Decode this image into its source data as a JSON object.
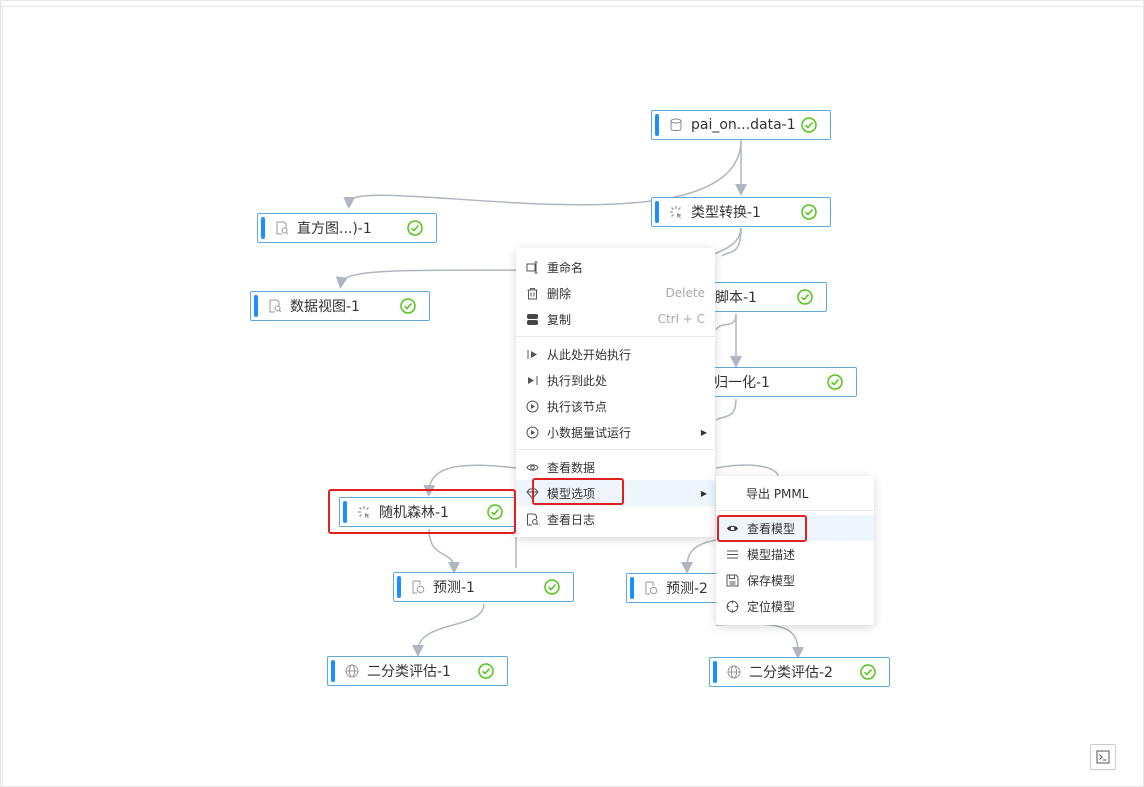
{
  "nodes": {
    "pai_data": "pai_on...data-1",
    "type_convert": "类型转换-1",
    "histogram": "直方图...)-1",
    "data_view": "数据视图-1",
    "sql_script": "脚本-1",
    "normalize": "归一化-1",
    "random_forest": "随机森林-1",
    "predict1": "预测-1",
    "predict2": "预测-2",
    "eval1": "二分类评估-1",
    "eval2": "二分类评估-2"
  },
  "context_menu": {
    "rename": "重命名",
    "delete": "删除",
    "delete_shortcut": "Delete",
    "copy": "复制",
    "copy_shortcut": "Ctrl + C",
    "run_from_here": "从此处开始执行",
    "run_to_here": "执行到此处",
    "run_node": "执行该节点",
    "small_data_run": "小数据量试运行",
    "view_data": "查看数据",
    "model_options": "模型选项",
    "view_log": "查看日志"
  },
  "submenu": {
    "export_pmml": "导出 PMML",
    "view_model": "查看模型",
    "model_description": "模型描述",
    "save_model": "保存模型",
    "locate_model": "定位模型"
  },
  "colors": {
    "node_border": "#5fa8e0",
    "node_bar": "#1890ff",
    "success": "#52c41a",
    "highlight": "#e02020",
    "edge": "#b0b6bf"
  },
  "icons": {
    "terminal": "terminal-icon"
  }
}
